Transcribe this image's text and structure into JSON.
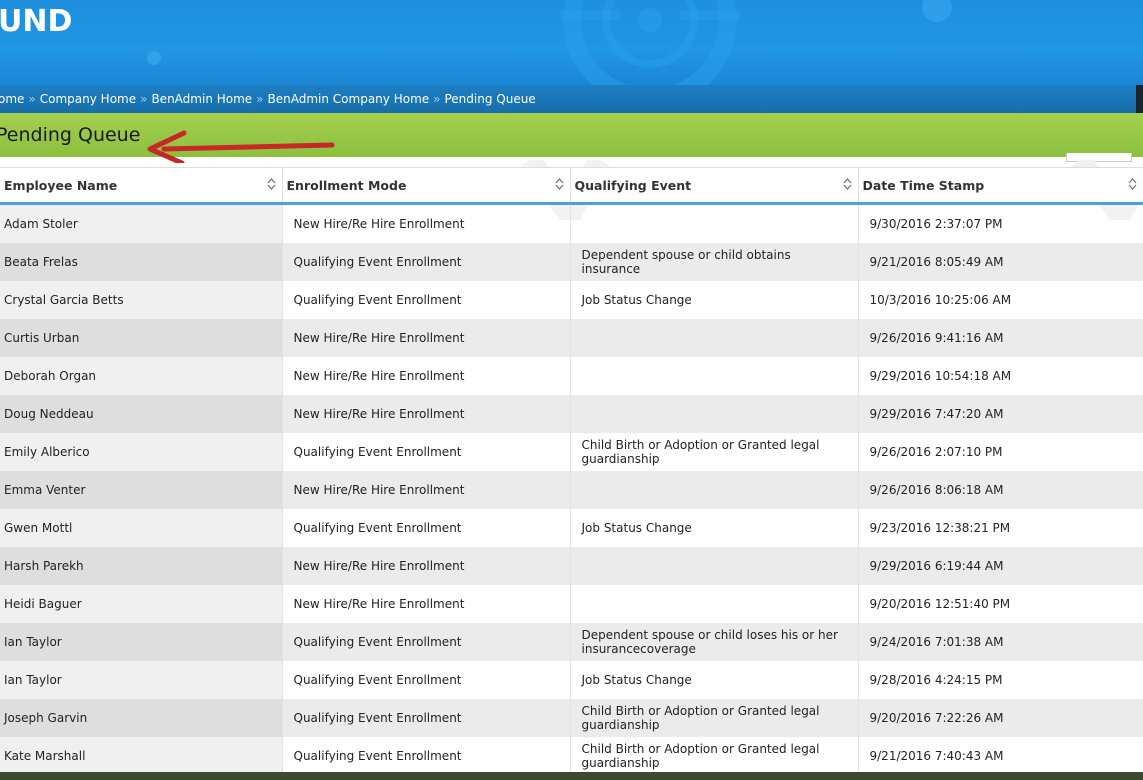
{
  "banner": {
    "logo_text": "UND"
  },
  "breadcrumb": [
    {
      "label": "ome"
    },
    {
      "label": "Company Home"
    },
    {
      "label": "BenAdmin Home"
    },
    {
      "label": "BenAdmin Company Home"
    },
    {
      "label": "Pending Queue"
    }
  ],
  "breadcrumb_separator": "»",
  "page": {
    "title": "Pending Queue"
  },
  "colors": {
    "banner_blue": "#2196e3",
    "breadcrumb_blue": "#176eaa",
    "title_green": "#8cc03e",
    "arrow_red": "#c62828",
    "header_underline": "#4aa3df"
  },
  "table": {
    "columns": [
      {
        "label": "Employee Name"
      },
      {
        "label": "Enrollment Mode"
      },
      {
        "label": "Qualifying Event"
      },
      {
        "label": "Date Time Stamp"
      }
    ],
    "rows": [
      [
        "Adam Stoler",
        "New Hire/Re Hire Enrollment",
        "",
        "9/30/2016 2:37:07 PM"
      ],
      [
        "Beata Frelas",
        "Qualifying Event Enrollment",
        "Dependent spouse or child obtains insurance",
        "9/21/2016 8:05:49 AM"
      ],
      [
        "Crystal Garcia Betts",
        "Qualifying Event Enrollment",
        "Job Status Change",
        "10/3/2016 10:25:06 AM"
      ],
      [
        "Curtis Urban",
        "New Hire/Re Hire Enrollment",
        "",
        "9/26/2016 9:41:16 AM"
      ],
      [
        "Deborah Organ",
        "New Hire/Re Hire Enrollment",
        "",
        "9/29/2016 10:54:18 AM"
      ],
      [
        "Doug Neddeau",
        "New Hire/Re Hire Enrollment",
        "",
        "9/29/2016 7:47:20 AM"
      ],
      [
        "Emily Alberico",
        "Qualifying Event Enrollment",
        "Child Birth or Adoption or Granted legal guardianship",
        "9/26/2016 2:07:10 PM"
      ],
      [
        "Emma Venter",
        "New Hire/Re Hire Enrollment",
        "",
        "9/26/2016 8:06:18 AM"
      ],
      [
        "Gwen Mottl",
        "Qualifying Event Enrollment",
        "Job Status Change",
        "9/23/2016 12:38:21 PM"
      ],
      [
        "Harsh Parekh",
        "New Hire/Re Hire Enrollment",
        "",
        "9/29/2016 6:19:44 AM"
      ],
      [
        "Heidi Baguer",
        "New Hire/Re Hire Enrollment",
        "",
        "9/20/2016 12:51:40 PM"
      ],
      [
        "Ian Taylor",
        "Qualifying Event Enrollment",
        "Dependent spouse or child loses his or her insurancecoverage",
        "9/24/2016 7:01:38 AM"
      ],
      [
        "Ian Taylor",
        "Qualifying Event Enrollment",
        "Job Status Change",
        "9/28/2016 4:24:15 PM"
      ],
      [
        "Joseph Garvin",
        "Qualifying Event Enrollment",
        "Child Birth or Adoption or Granted legal guardianship",
        "9/20/2016 7:22:26 AM"
      ],
      [
        "Kate Marshall",
        "Qualifying Event Enrollment",
        "Child Birth or Adoption or Granted legal guardianship",
        "9/21/2016 7:40:43 AM"
      ]
    ]
  }
}
